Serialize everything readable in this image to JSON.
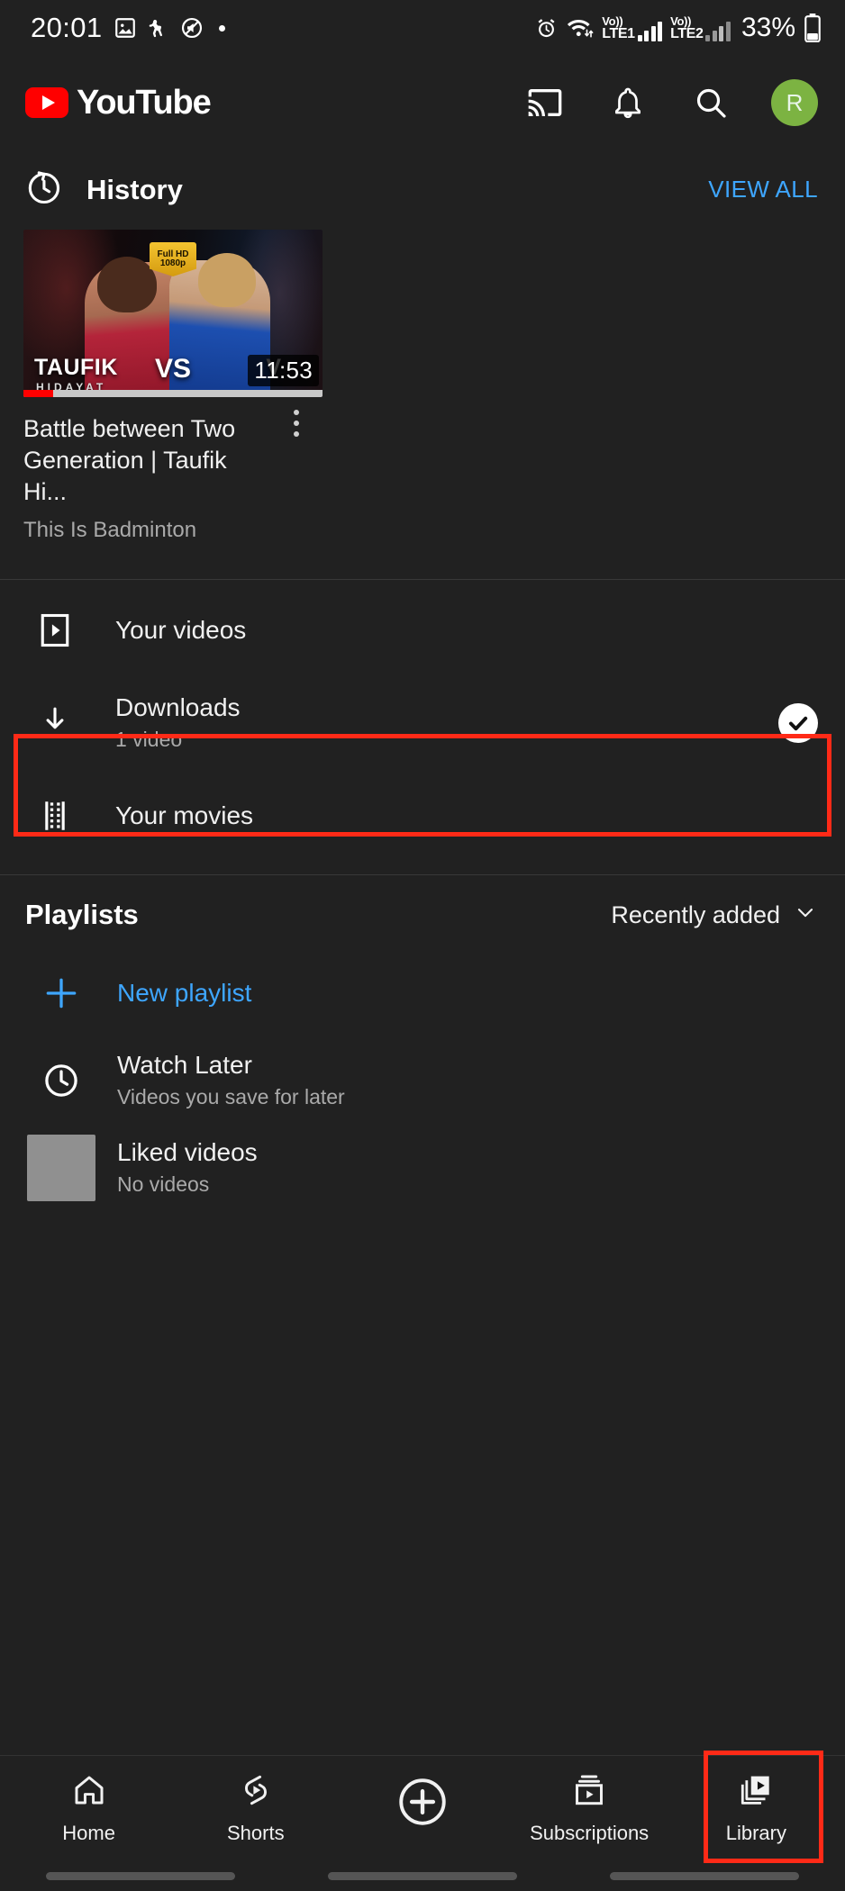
{
  "status_bar": {
    "time": "20:01",
    "left_icons": [
      "photo-icon",
      "dog-walk-icon",
      "mute-icon",
      "dot-icon"
    ],
    "alarm_icon": "alarm-icon",
    "wifi_icon": "wifi-icon",
    "sim1_label_top": "Vo))",
    "sim1_label_bottom": "LTE1",
    "sim2_label_top": "Vo))",
    "sim2_label_bottom": "LTE2",
    "battery_percent": "33%"
  },
  "header": {
    "logo_text": "YouTube",
    "actions": [
      {
        "name": "cast-icon",
        "label": "Cast"
      },
      {
        "name": "bell-icon",
        "label": "Notifications"
      },
      {
        "name": "search-icon",
        "label": "Search"
      }
    ],
    "avatar_letter": "R",
    "avatar_color": "#7cb342"
  },
  "history": {
    "section_title": "History",
    "history_icon": "history-clock-icon",
    "view_all_label": "VIEW ALL",
    "accent_color": "#3ea6ff",
    "video": {
      "title": "Battle between Two Generation | Taufik Hi...",
      "channel": "This Is Badminton",
      "duration": "11:53",
      "progress_percent": 10,
      "thumb_name_left": "TAUFIK",
      "thumb_sub_left": "HIDAYAT",
      "thumb_vs": "VS",
      "thumb_name_right": "V",
      "thumb_badge_line1": "Full HD",
      "thumb_badge_line2": "1080p",
      "menu_icon": "kebab-menu-icon"
    }
  },
  "library_rows": [
    {
      "id": "your-videos",
      "icon": "video-play-box-icon",
      "title": "Your videos",
      "subtitle": "",
      "badge": "",
      "highlighted": false
    },
    {
      "id": "downloads",
      "icon": "download-arrow-icon",
      "title": "Downloads",
      "subtitle": "1 video",
      "badge": "check-circle-icon",
      "highlighted": true
    },
    {
      "id": "your-movies",
      "icon": "film-strip-icon",
      "title": "Your movies",
      "subtitle": "",
      "badge": "",
      "highlighted": false
    }
  ],
  "playlists": {
    "section_title": "Playlists",
    "sort_label": "Recently added",
    "sort_icon": "chevron-down-icon",
    "items": [
      {
        "id": "new-playlist",
        "icon": "plus-icon",
        "title": "New playlist",
        "subtitle": "",
        "is_link": true
      },
      {
        "id": "watch-later",
        "icon": "clock-icon",
        "title": "Watch Later",
        "subtitle": "Videos you save for later",
        "is_link": false
      },
      {
        "id": "liked-videos",
        "icon": "placeholder-thumbnail",
        "title": "Liked videos",
        "subtitle": "No videos",
        "is_link": false
      }
    ]
  },
  "bottom_nav": {
    "items": [
      {
        "id": "home",
        "label": "Home",
        "icon": "home-icon",
        "active": false
      },
      {
        "id": "shorts",
        "label": "Shorts",
        "icon": "shorts-icon",
        "active": false
      },
      {
        "id": "create",
        "label": "",
        "icon": "plus-circle-icon",
        "active": false
      },
      {
        "id": "subscriptions",
        "label": "Subscriptions",
        "icon": "subscriptions-icon",
        "active": false
      },
      {
        "id": "library",
        "label": "Library",
        "icon": "library-icon",
        "active": true
      }
    ]
  },
  "highlights": {
    "color": "#ff2a17",
    "targets": [
      "downloads-row",
      "library-tab"
    ]
  }
}
